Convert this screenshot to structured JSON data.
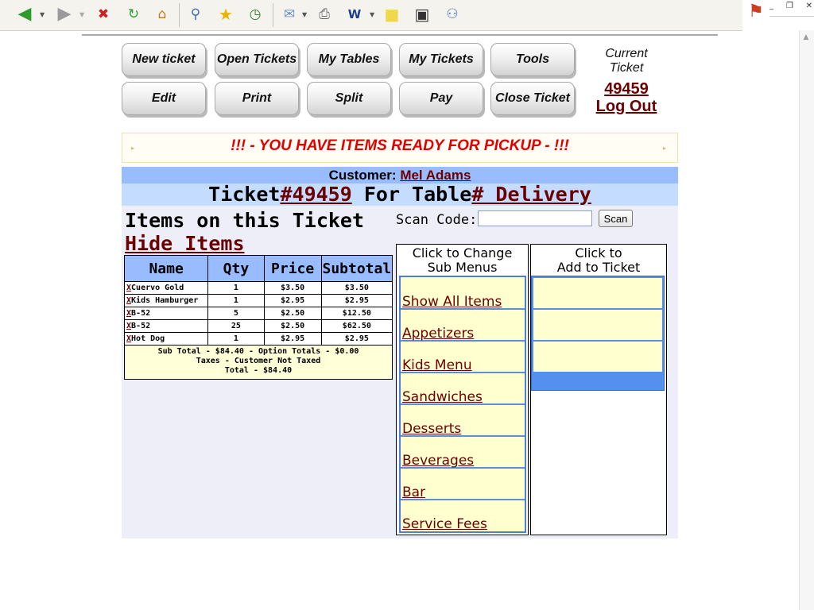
{
  "pos": {
    "buttons_row1": [
      "New ticket",
      "Open Tickets",
      "My Tables",
      "My Tickets",
      "Tools"
    ],
    "buttons_row2": [
      "Edit",
      "Print",
      "Split",
      "Pay",
      "Close Ticket"
    ],
    "current_ticket_label": "Current Ticket",
    "current_ticket_number": "49459",
    "logout": "Log Out"
  },
  "marquee": {
    "text": "!!! - YOU HAVE ITEMS READY FOR PICKUP - !!!"
  },
  "customer": {
    "label": "Customer:",
    "name": "Mel Adams"
  },
  "ticket": {
    "prefix": "Ticket",
    "number": "#49459",
    "middle": "For Table",
    "table": "# Delivery"
  },
  "items": {
    "title": "Items on this Ticket",
    "hide_link": "Hide Items",
    "columns": [
      "Name",
      "Qty",
      "Price",
      "Subtotal"
    ],
    "delete_mark": "X",
    "rows": [
      {
        "name": "Cuervo Gold",
        "qty": "1",
        "price": "$3.50",
        "subtotal": "$3.50"
      },
      {
        "name": "Kids Hamburger",
        "qty": "1",
        "price": "$2.95",
        "subtotal": "$2.95"
      },
      {
        "name": "B-52",
        "qty": "5",
        "price": "$2.50",
        "subtotal": "$12.50"
      },
      {
        "name": "B-52",
        "qty": "25",
        "price": "$2.50",
        "subtotal": "$62.50"
      },
      {
        "name": "Hot Dog",
        "qty": "1",
        "price": "$2.95",
        "subtotal": "$2.95"
      }
    ],
    "totals": {
      "line1": "Sub Total - $84.40 - Option Totals - $0.00",
      "line2": "Taxes - Customer Not Taxed",
      "line3": "Total - $84.40"
    }
  },
  "scan": {
    "label": "Scan Code:",
    "value": "",
    "button": "Scan"
  },
  "submenus": {
    "header_line1": "Click to Change",
    "header_line2": "Sub Menus",
    "items": [
      "Show All Items",
      "Appetizers",
      "Kids Menu",
      "Sandwiches",
      "Desserts",
      "Beverages",
      "Bar",
      "Service Fees"
    ]
  },
  "add": {
    "header_line1": "Click to",
    "header_line2": "Add to Ticket"
  },
  "colors": {
    "link": "#6b0000",
    "header_blue": "#99bbff",
    "alert_red": "#e00000"
  }
}
